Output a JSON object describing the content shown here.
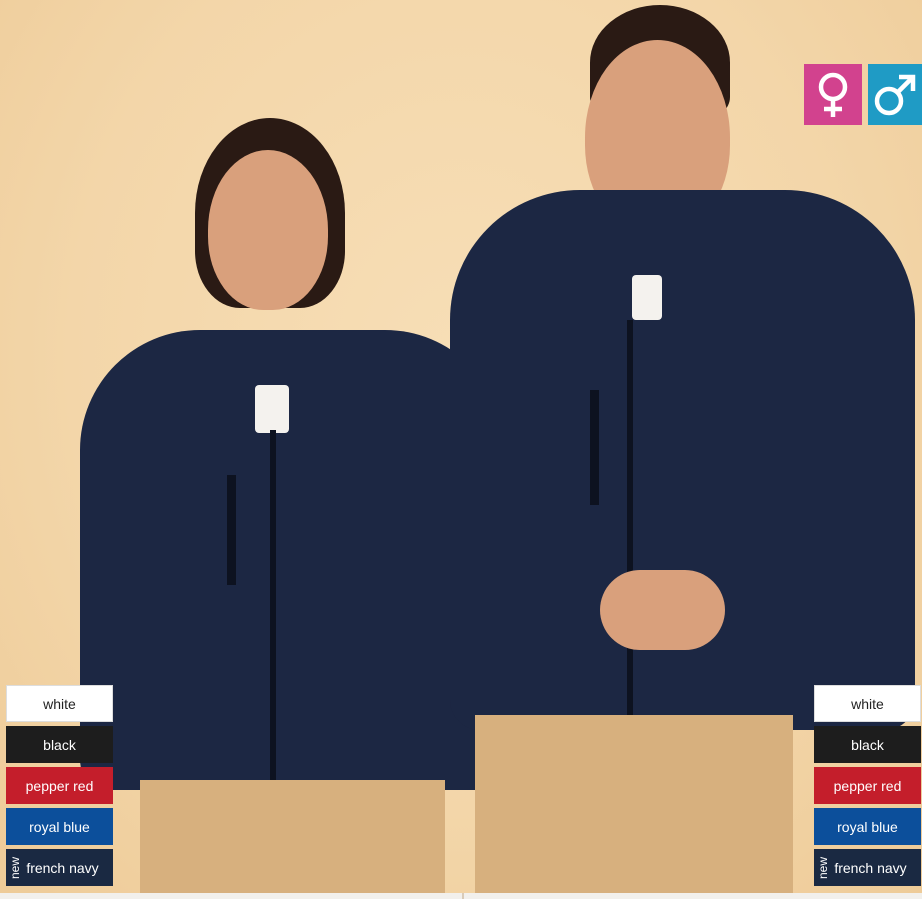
{
  "gender_icons": {
    "female": {
      "glyph": "♀",
      "icon": "female-symbol-icon",
      "color": "#d2428e"
    },
    "male": {
      "glyph": "♂",
      "icon": "male-symbol-icon",
      "color": "#1f9bc5"
    }
  },
  "colors_left": [
    {
      "label": "white",
      "hex": "#ffffff"
    },
    {
      "label": "black",
      "hex": "#1d1d1d"
    },
    {
      "label": "pepper red",
      "hex": "#c41e2b"
    },
    {
      "label": "royal blue",
      "hex": "#0c4f9b"
    },
    {
      "label": "french navy",
      "hex": "#1a2942",
      "tag": "new"
    }
  ],
  "colors_right": [
    {
      "label": "white",
      "hex": "#ffffff"
    },
    {
      "label": "black",
      "hex": "#1d1d1d"
    },
    {
      "label": "pepper red",
      "hex": "#c41e2b"
    },
    {
      "label": "royal blue",
      "hex": "#0c4f9b"
    },
    {
      "label": "french navy",
      "hex": "#1a2942",
      "tag": "new"
    }
  ]
}
